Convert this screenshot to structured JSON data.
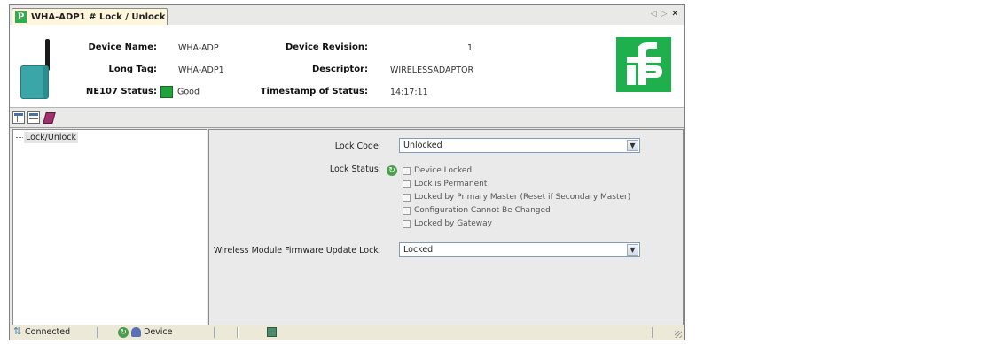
{
  "tab": {
    "title": "WHA-ADP1 # Lock / Unlock",
    "icon": "pf-logo-icon"
  },
  "tab_nav": {
    "prev": "◁",
    "next": "▷",
    "close": "✕"
  },
  "header": {
    "device_name_label": "Device Name:",
    "device_name": "WHA-ADP",
    "long_tag_label": "Long Tag:",
    "long_tag": "WHA-ADP1",
    "ne107_label": "NE107 Status:",
    "ne107_value": "Good",
    "revision_label": "Device Revision:",
    "revision": "1",
    "descriptor_label": "Descriptor:",
    "descriptor": "WIRELESSADAPTOR",
    "timestamp_label": "Timestamp of Status:",
    "timestamp": "14:17:11"
  },
  "toolbar": {
    "icons": [
      "layout-icon",
      "table-icon",
      "book-icon"
    ]
  },
  "tree": {
    "items": [
      {
        "label": "Lock/Unlock"
      }
    ]
  },
  "form": {
    "lock_code_label": "Lock Code:",
    "lock_code_value": "Unlocked",
    "lock_status_label": "Lock Status:",
    "lock_status_options": [
      {
        "label": "Device Locked",
        "checked": false
      },
      {
        "label": "Lock is Permanent",
        "checked": false
      },
      {
        "label": "Locked by Primary Master (Reset if Secondary Master)",
        "checked": false
      },
      {
        "label": "Configuration Cannot Be Changed",
        "checked": false
      },
      {
        "label": "Locked by Gateway",
        "checked": false
      }
    ],
    "firmware_lock_label": "Wireless Module Firmware Update Lock:",
    "firmware_lock_value": "Locked"
  },
  "statusbar": {
    "connection": "Connected",
    "device": "Device"
  },
  "colors": {
    "accent_green": "#1fb04d",
    "status_good": "#1fa33b",
    "tab_bg": "#fff6dc"
  }
}
